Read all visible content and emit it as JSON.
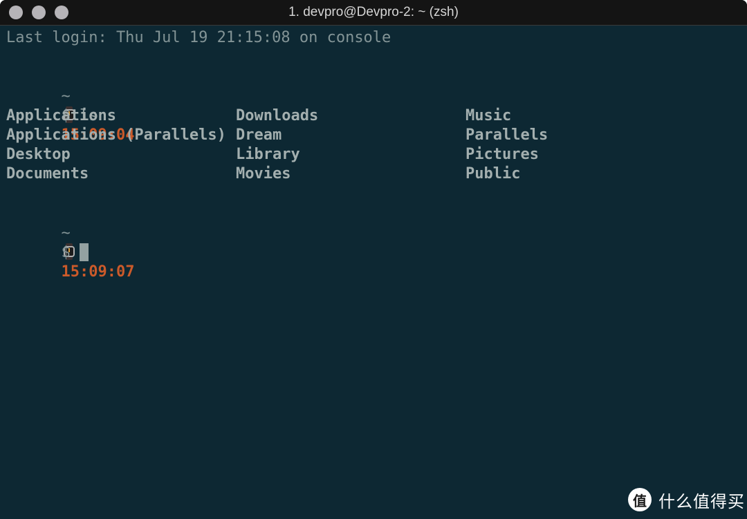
{
  "window": {
    "title": "1. devpro@Devpro-2: ~ (zsh)",
    "traffic_lights": [
      "close-button",
      "minimize-button",
      "zoom-button"
    ]
  },
  "terminal": {
    "last_login": "Last login: Thu Jul 19 21:15:08 on console",
    "prompts": [
      {
        "cwd": "~",
        "icon": "watch-icon",
        "time": "15:09:04",
        "symbol": "$",
        "command": "ls"
      },
      {
        "cwd": "~",
        "icon": "watch-icon",
        "time": "15:09:07",
        "symbol": "$",
        "command": ""
      }
    ],
    "ls_output": {
      "columns": [
        [
          "Applications",
          "Applications (Parallels)",
          "Desktop",
          "Documents"
        ],
        [
          "Downloads",
          "Dream",
          "Library",
          "Movies"
        ],
        [
          "Music",
          "Parallels",
          "Pictures",
          "Public"
        ]
      ]
    }
  },
  "watermark": {
    "badge": "值",
    "text": "什么值得买"
  },
  "colors": {
    "background": "#0d2833",
    "titlebar": "#141414",
    "text": "#93a1a1",
    "time": "#cb5a2a"
  }
}
